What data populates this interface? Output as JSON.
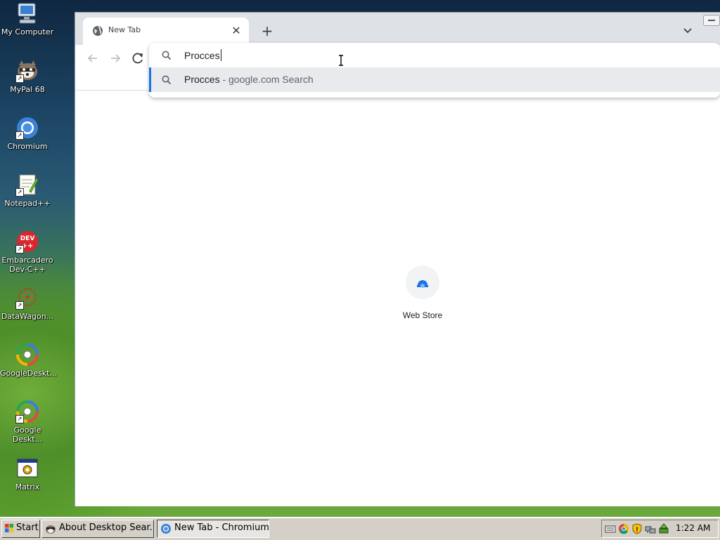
{
  "desktop": {
    "icons": [
      {
        "label": "My Computer",
        "icon": "computer-icon"
      },
      {
        "label": "MyPal 68",
        "icon": "mypal-icon"
      },
      {
        "label": "Chromium",
        "icon": "chromium-icon"
      },
      {
        "label": "Notepad++",
        "icon": "notepadpp-icon"
      },
      {
        "label": "Embarcadero Dev-C++",
        "icon": "devcpp-icon"
      },
      {
        "label": "DataWagon...",
        "icon": "datawagon-icon"
      },
      {
        "label": "GoogleDeskt...",
        "icon": "google-desktop-icon"
      },
      {
        "label": "Google Deskt...",
        "icon": "google-desktop-icon"
      },
      {
        "label": "Matrix",
        "icon": "matrix-icon"
      }
    ]
  },
  "browser": {
    "tab": {
      "title": "New Tab",
      "favicon": "globe-icon"
    },
    "omnibox": {
      "value": "Procces "
    },
    "suggestions": [
      {
        "query": "Procces",
        "source": " - google.com Search",
        "icon": "search-icon"
      }
    ],
    "ntp": {
      "shortcuts": [
        {
          "label": "Web Store",
          "icon": "web-store-icon"
        }
      ]
    }
  },
  "taskbar": {
    "start_label": "Start",
    "tasks": [
      {
        "title": "About Desktop Sear...",
        "icon": "mypal-icon",
        "active": false
      },
      {
        "title": "New Tab - Chromium",
        "icon": "chromium-icon",
        "active": true
      }
    ],
    "clock": "1:22 AM"
  },
  "colors": {
    "accent": "#1a73e8",
    "tabstrip": "#dee1e6",
    "taskbar": "#d4d0c8"
  }
}
